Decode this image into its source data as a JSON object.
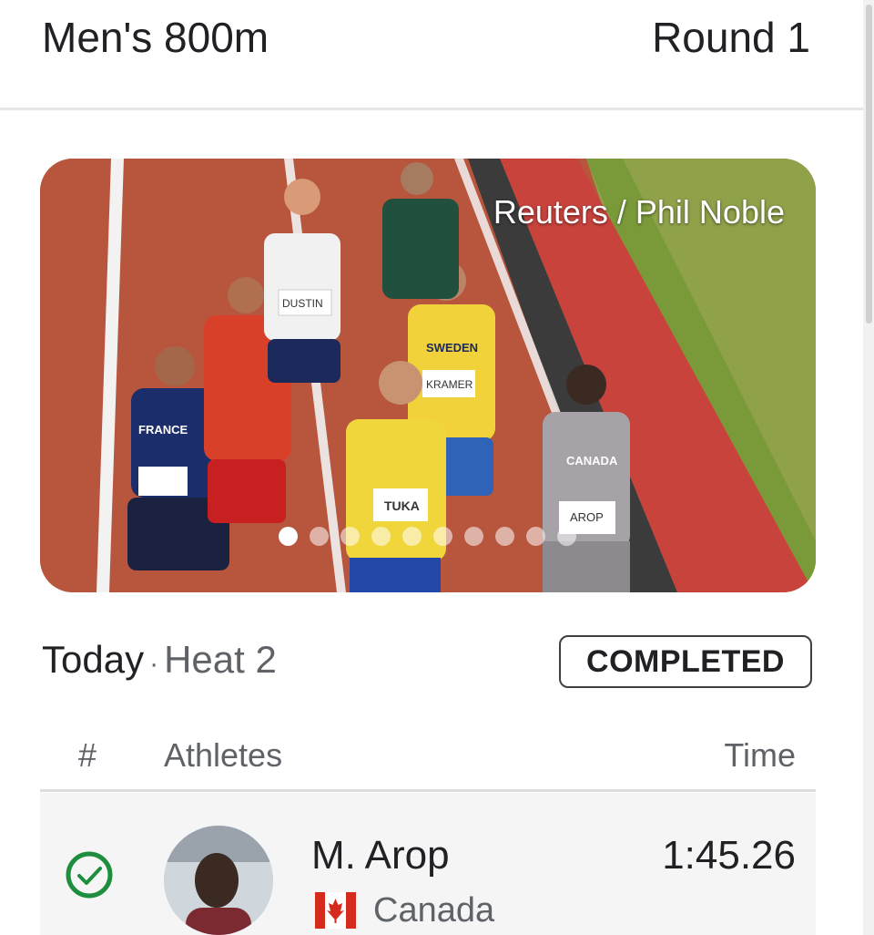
{
  "header": {
    "event": "Men's 800m",
    "round": "Round 1"
  },
  "hero": {
    "credit": "Reuters / Phil Noble",
    "carousel_page_count": 10,
    "carousel_active_index": 0,
    "bib_labels": [
      "DUSTIN",
      "KRAMER",
      "TUKA",
      "AROP",
      "FRANCE",
      "SWEDEN",
      "CANADA"
    ]
  },
  "heat": {
    "day": "Today",
    "separator": "·",
    "name": "Heat 2",
    "status": "COMPLETED"
  },
  "table": {
    "headers": {
      "rank": "#",
      "athletes": "Athletes",
      "time": "Time"
    },
    "rows": [
      {
        "name": "M. Arop",
        "country": "Canada",
        "time": "1:45.26",
        "qualified_icon": "check-circle-icon",
        "flag_icon": "canada-flag-icon"
      }
    ]
  },
  "colors": {
    "accent_green": "#1e8e3e",
    "track_red": "#b7553d",
    "flag_red": "#d52b1e"
  }
}
